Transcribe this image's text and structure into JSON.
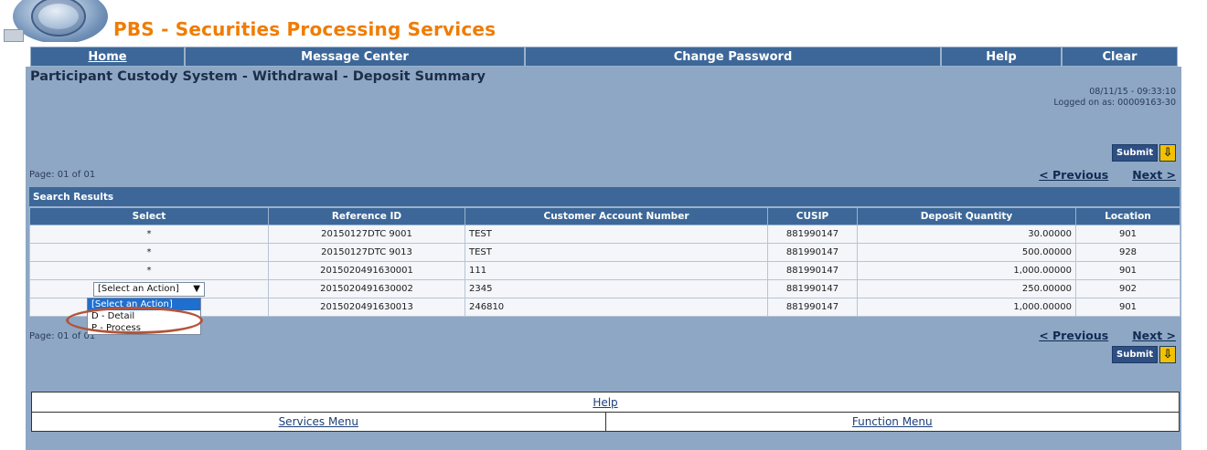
{
  "header": {
    "title": "PBS - Securities Processing Services"
  },
  "nav": [
    {
      "label": "Home"
    },
    {
      "label": "Message Center"
    },
    {
      "label": "Change Password"
    },
    {
      "label": "Help"
    },
    {
      "label": "Clear"
    }
  ],
  "page": {
    "title": "Participant Custody System - Withdrawal - Deposit Summary",
    "datetime": "08/11/15 - 09:33:10",
    "logged_on": "Logged on as:  00009163-30",
    "submit_label": "Submit",
    "page_indicator_top": "Page: 01 of 01",
    "page_indicator_bottom": "Page: 01 of 01",
    "previous_label": "< Previous",
    "next_label": "Next >"
  },
  "results": {
    "heading": "Search Results",
    "columns": [
      "Select",
      "Reference ID",
      "Customer Account Number",
      "CUSIP",
      "Deposit Quantity",
      "Location"
    ],
    "rows": [
      {
        "select": "*",
        "reference_id": "20150127DTC 9001",
        "account": "TEST",
        "cusip": "881990147",
        "quantity": "30.00000",
        "location": "901"
      },
      {
        "select": "*",
        "reference_id": "20150127DTC 9013",
        "account": "TEST",
        "cusip": "881990147",
        "quantity": "500.00000",
        "location": "928"
      },
      {
        "select": "*",
        "reference_id": "2015020491630001",
        "account": "111",
        "cusip": "881990147",
        "quantity": "1,000.00000",
        "location": "901"
      },
      {
        "select": "[Select an Action]",
        "reference_id": "2015020491630002",
        "account": "2345",
        "cusip": "881990147",
        "quantity": "250.00000",
        "location": "902"
      },
      {
        "select": "",
        "reference_id": "2015020491630013",
        "account": "246810",
        "cusip": "881990147",
        "quantity": "1,000.00000",
        "location": "901"
      }
    ]
  },
  "dropdown": {
    "options": [
      "[Select an Action]",
      "D - Detail",
      "P - Process"
    ],
    "highlighted": "[Select an Action]"
  },
  "footer": {
    "help": "Help",
    "services_menu": "Services Menu",
    "function_menu": "Function Menu"
  }
}
